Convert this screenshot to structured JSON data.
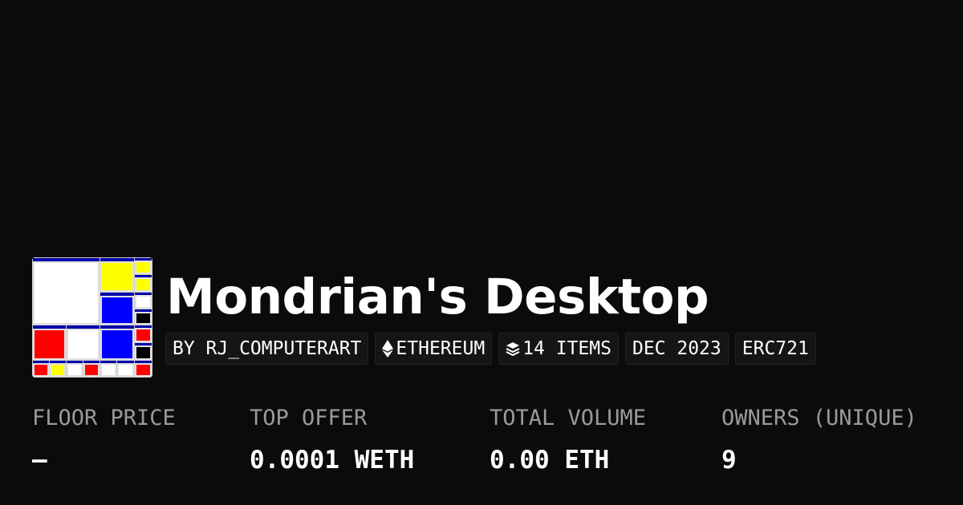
{
  "collection": {
    "title": "Mondrian's Desktop",
    "creator": "BY RJ_COMPUTERART",
    "chain": "ETHEREUM",
    "chain_icon": "ethereum-icon",
    "items": "14 ITEMS",
    "items_icon": "layers-icon",
    "date": "DEC 2023",
    "standard": "ERC721",
    "thumbnail_colors": [
      "#0000aa",
      "#ffff00",
      "#0000ff",
      "#ff0000",
      "#ffffff",
      "#000000"
    ]
  },
  "stats": [
    {
      "label": "FLOOR PRICE",
      "value": "–"
    },
    {
      "label": "TOP OFFER",
      "value": "0.0001 WETH"
    },
    {
      "label": "TOTAL VOLUME",
      "value": "0.00 ETH"
    },
    {
      "label": "OWNERS (UNIQUE)",
      "value": "9"
    }
  ]
}
